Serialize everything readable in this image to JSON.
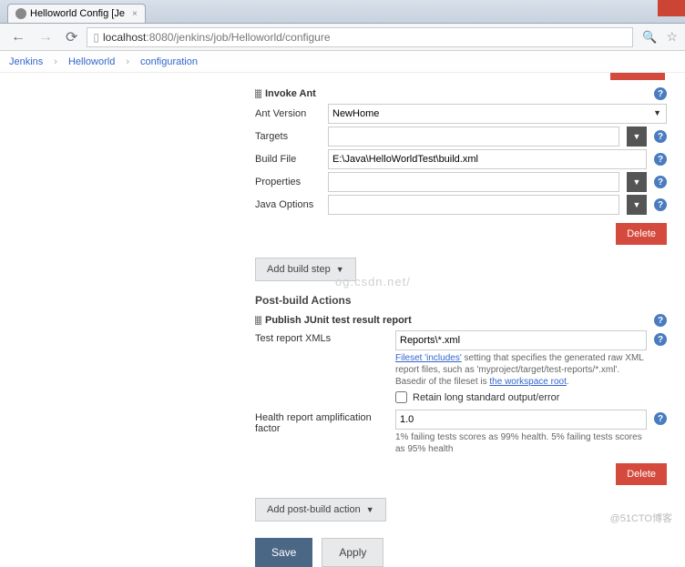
{
  "browser": {
    "tab_title": "Helloworld Config [Je",
    "url_host": "localhost",
    "url_port_path": ":8080/jenkins/job/Helloworld/configure"
  },
  "breadcrumb": {
    "items": [
      "Jenkins",
      "Helloworld",
      "configuration"
    ]
  },
  "invoke_ant": {
    "title": "Invoke Ant",
    "labels": {
      "ant_version": "Ant Version",
      "targets": "Targets",
      "build_file": "Build File",
      "properties": "Properties",
      "java_options": "Java Options"
    },
    "values": {
      "ant_version": "NewHome",
      "targets": "",
      "build_file": "E:\\Java\\HelloWorldTest\\build.xml",
      "properties": "",
      "java_options": ""
    }
  },
  "buttons": {
    "delete": "Delete",
    "add_build_step": "Add build step",
    "add_post_build": "Add post-build action",
    "save": "Save",
    "apply": "Apply"
  },
  "headings": {
    "post_build": "Post-build Actions"
  },
  "junit": {
    "title": "Publish JUnit test result report",
    "labels": {
      "xmls": "Test report XMLs",
      "retain": "Retain long standard output/error",
      "amp": "Health report amplification factor"
    },
    "values": {
      "xmls": "Reports\\*.xml",
      "amp": "1.0"
    },
    "hints": {
      "fileset1": "Fileset 'includes'",
      "fileset2": " setting that specifies the generated raw XML report files, such as 'myproject/target/test-reports/*.xml'. Basedir of the fileset is ",
      "fileset3": "the workspace root",
      "health": "1% failing tests scores as 99% health. 5% failing tests scores as 95% health"
    }
  },
  "watermark": "og.csdn.net/",
  "attribution": "@51CTO博客"
}
